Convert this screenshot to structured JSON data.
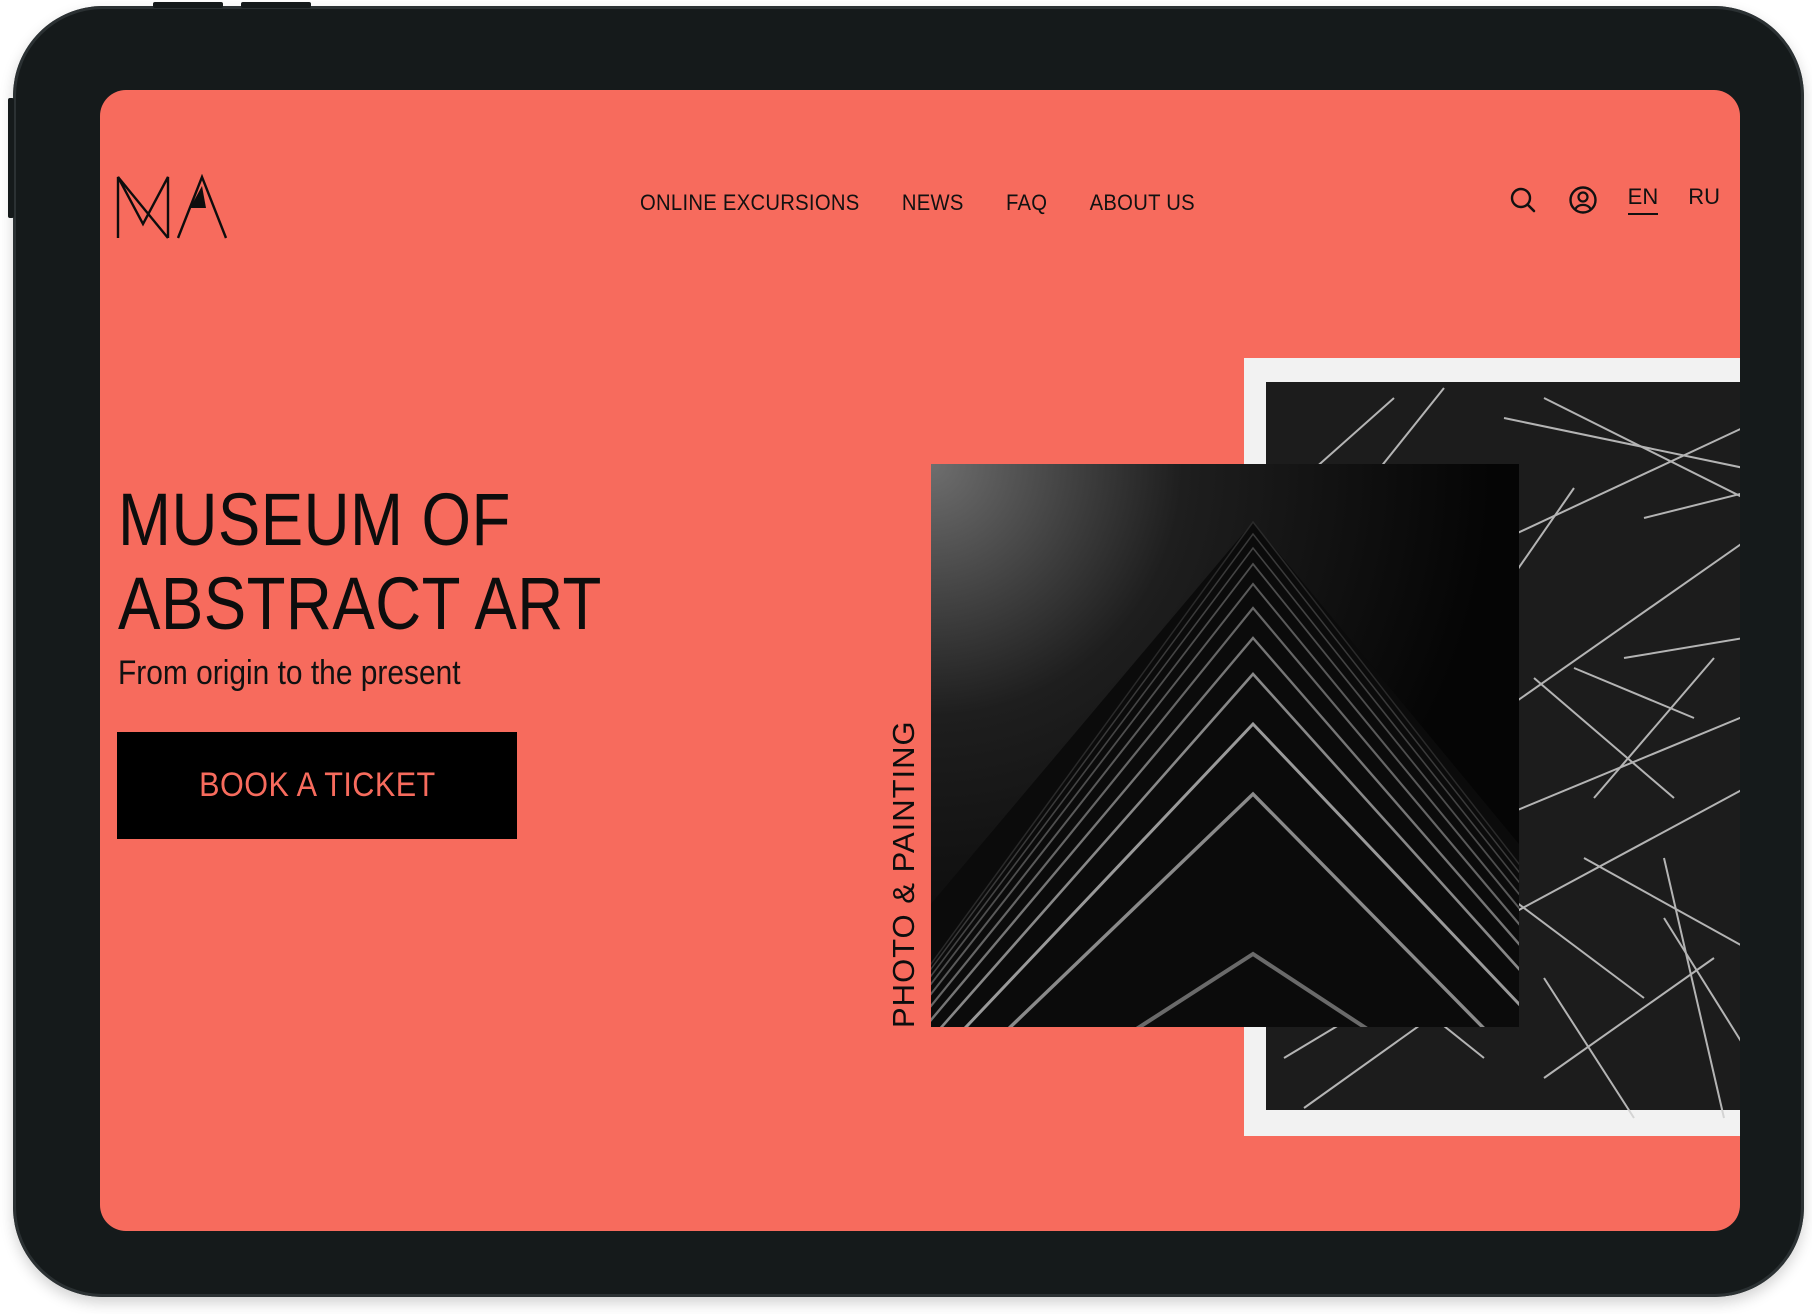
{
  "nav": {
    "links": [
      "ONLINE EXCURSIONS",
      "NEWS",
      "FAQ",
      "ABOUT US"
    ],
    "languages": {
      "en": "EN",
      "ru": "RU",
      "active": "EN"
    }
  },
  "icons": {
    "logo": "ma-monogram-logo",
    "search": "search-icon",
    "account": "user-account-icon"
  },
  "hero": {
    "title_line1": "MUSEUM OF",
    "title_line2": "ABSTRACT ART",
    "subtitle": "From origin to the present",
    "cta_label": "BOOK A TICKET"
  },
  "gallery": {
    "category_label": "PHOTO & PAINTING"
  },
  "colors": {
    "accent": "#f76b5d",
    "text": "#0d0d0d",
    "device_frame": "#151a1b",
    "button_bg": "#000000"
  }
}
